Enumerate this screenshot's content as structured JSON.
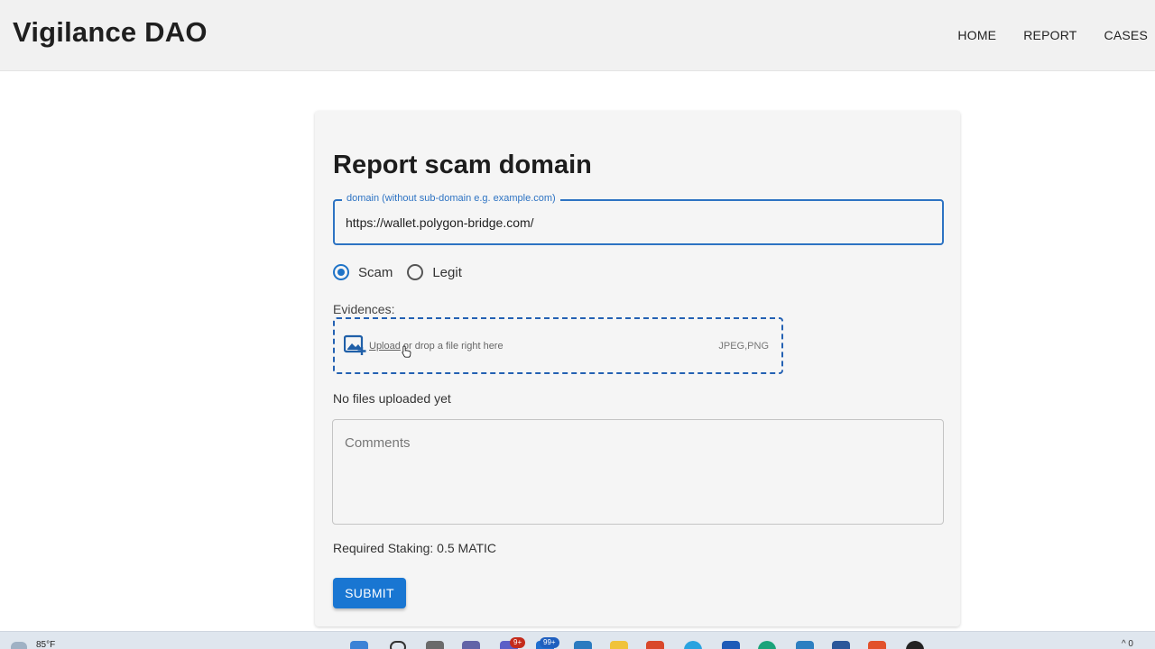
{
  "header": {
    "brand": "Vigilance DAO",
    "nav": [
      "HOME",
      "REPORT",
      "CASES"
    ]
  },
  "form": {
    "title": "Report scam domain",
    "domain_label": "domain (without sub-domain e.g. example.com)",
    "domain_value": "https://wallet.polygon-bridge.com/",
    "radio_options": [
      "Scam",
      "Legit"
    ],
    "selected_option": "Scam",
    "evidence_label": "Evidences:",
    "upload_link": "Upload",
    "upload_rest": " or drop a file right here",
    "file_types": "JPEG,PNG",
    "no_files": "No files uploaded yet",
    "comments_placeholder": "Comments",
    "staking": "Required Staking: 0.5 MATIC",
    "submit_label": "SUBMIT"
  },
  "taskbar": {
    "temperature": "85°F",
    "badge_chat": "9+",
    "badge_mail": "99+",
    "tray_text": "^  0",
    "icons": [
      "windows-icon",
      "search-icon",
      "task-view-icon",
      "teams-icon",
      "chat-icon",
      "mail-icon",
      "store-icon",
      "folder-icon",
      "office-icon",
      "telegram-icon",
      "app-icon",
      "edge-icon",
      "calculator-icon",
      "word-icon",
      "brave-icon",
      "github-icon"
    ]
  },
  "colors": {
    "primary": "#1976d2",
    "field_border": "#2d73c3",
    "dropzone_border": "#2461b3"
  }
}
